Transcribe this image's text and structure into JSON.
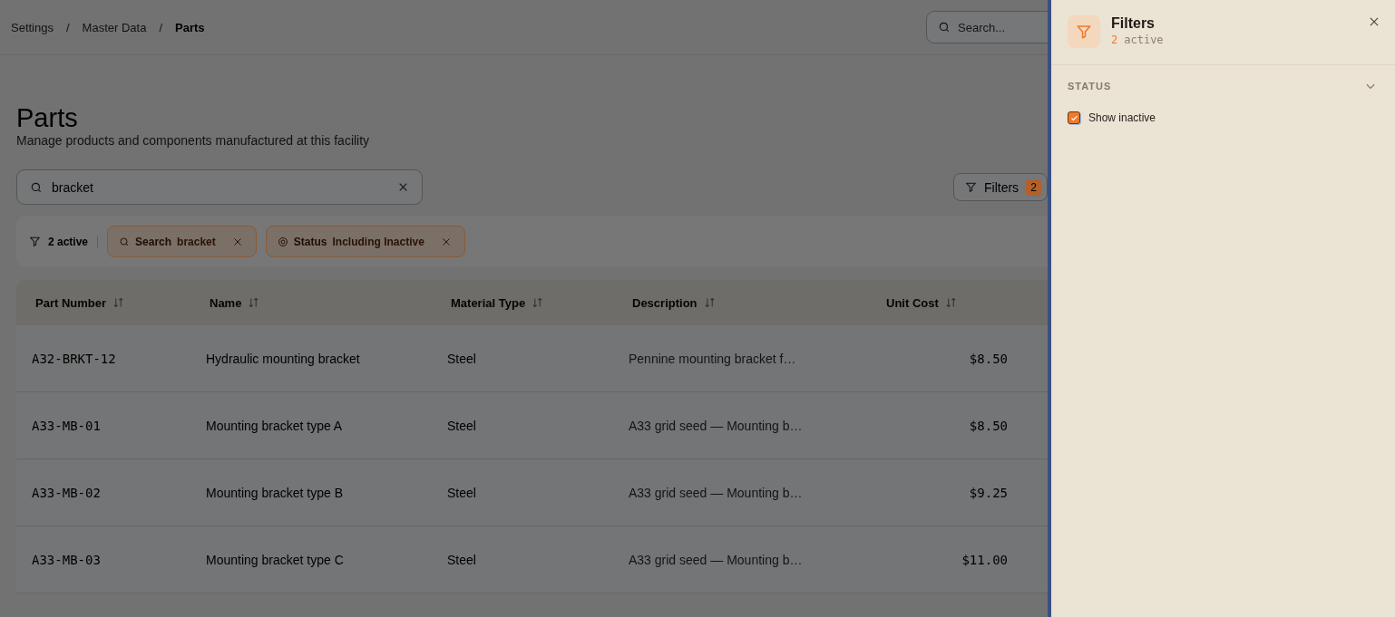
{
  "breadcrumb_separator": "/",
  "breadcrumbs": [
    {
      "label": "Settings",
      "current": false
    },
    {
      "label": "Master Data",
      "current": false
    },
    {
      "label": "Parts",
      "current": true
    }
  ],
  "global_search": {
    "placeholder": "Search..."
  },
  "page": {
    "title": "Parts",
    "subtitle": "Manage products and components manufactured at this facility"
  },
  "search": {
    "value": "bracket"
  },
  "filters_button": {
    "label": "Filters",
    "count": "2"
  },
  "active_filters": {
    "summary": "2 active",
    "chips": [
      {
        "kind": "search",
        "label": "Search",
        "value": "bracket"
      },
      {
        "kind": "status",
        "label": "Status",
        "value": "Including Inactive"
      }
    ]
  },
  "table": {
    "columns": [
      {
        "label": "Part Number",
        "kind": "code"
      },
      {
        "label": "Name",
        "kind": "text"
      },
      {
        "label": "Material Type",
        "kind": "text"
      },
      {
        "label": "Description",
        "kind": "note"
      },
      {
        "label": "Unit Cost",
        "kind": "money"
      }
    ],
    "rows": [
      [
        "A32-BRKT-12",
        "Hydraulic mounting bracket",
        "Steel",
        "Pennine mounting bracket f…",
        "$8.50"
      ],
      [
        "A33-MB-01",
        "Mounting bracket type A",
        "Steel",
        "A33 grid seed — Mounting b…",
        "$8.50"
      ],
      [
        "A33-MB-02",
        "Mounting bracket type B",
        "Steel",
        "A33 grid seed — Mounting b…",
        "$9.25"
      ],
      [
        "A33-MB-03",
        "Mounting bracket type C",
        "Steel",
        "A33 grid seed — Mounting b…",
        "$11.00"
      ]
    ]
  },
  "drawer": {
    "title": "Filters",
    "count": "2",
    "count_label": "active",
    "sections": [
      {
        "title": "STATUS",
        "expanded": true,
        "options": [
          {
            "label": "Show inactive",
            "checked": true
          }
        ]
      }
    ]
  }
}
